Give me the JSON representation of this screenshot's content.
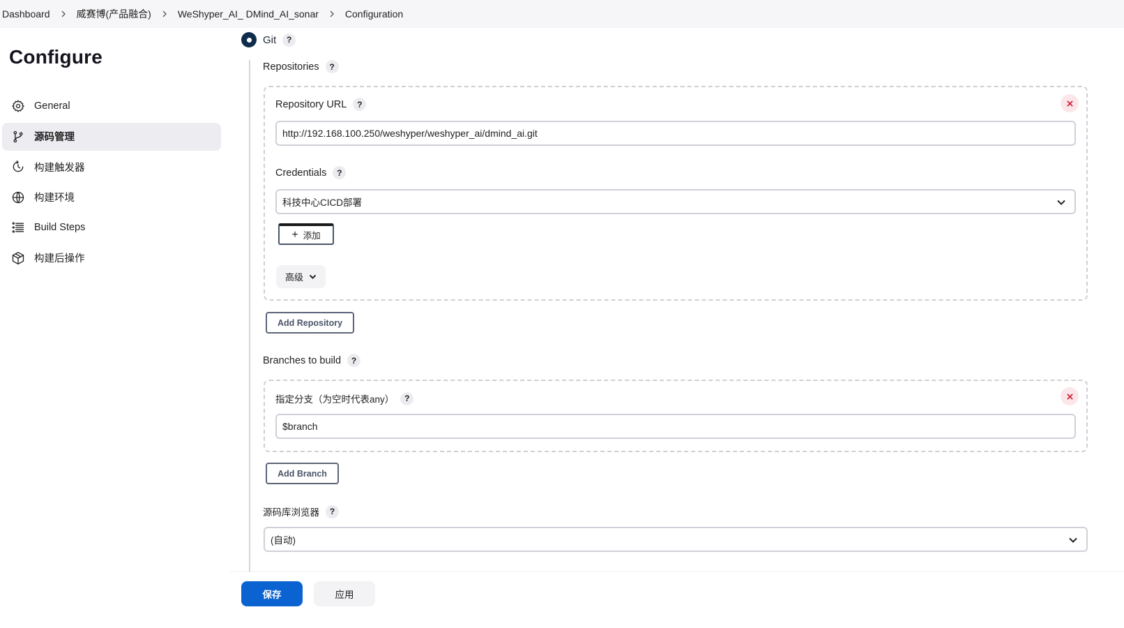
{
  "breadcrumb": {
    "items": [
      "Dashboard",
      "威赛博(产品融合)",
      "WeShyper_AI_ DMind_AI_sonar",
      "Configuration"
    ]
  },
  "sidebar": {
    "title": "Configure",
    "items": [
      {
        "label": "General",
        "icon": "gear-icon",
        "active": false
      },
      {
        "label": "源码管理",
        "icon": "branch-icon",
        "active": true
      },
      {
        "label": "构建触发器",
        "icon": "clock-icon",
        "active": false
      },
      {
        "label": "构建环境",
        "icon": "globe-icon",
        "active": false
      },
      {
        "label": "Build Steps",
        "icon": "list-icon",
        "active": false
      },
      {
        "label": "构建后操作",
        "icon": "package-icon",
        "active": false
      }
    ]
  },
  "scm": {
    "option_label": "Git",
    "repositories_label": "Repositories",
    "repository_url_label": "Repository URL",
    "repository_url_value": "http://192.168.100.250/weshyper/weshyper_ai/dmind_ai.git",
    "credentials_label": "Credentials",
    "credentials_value": "科技中心CICD部署",
    "add_label": "添加",
    "advanced_label": "高级",
    "add_repository_label": "Add Repository",
    "branches_label": "Branches to build",
    "branch_specifier_label": "指定分支（为空时代表any）",
    "branch_value": "$branch",
    "add_branch_label": "Add Branch",
    "repo_browser_label": "源码库浏览器",
    "repo_browser_value": "(自动)",
    "help_symbol": "?"
  },
  "footer": {
    "save_label": "保存",
    "apply_label": "应用"
  },
  "colors": {
    "primary": "#0b63d1",
    "radio": "#0f2c4c",
    "danger": "#d3243b"
  }
}
